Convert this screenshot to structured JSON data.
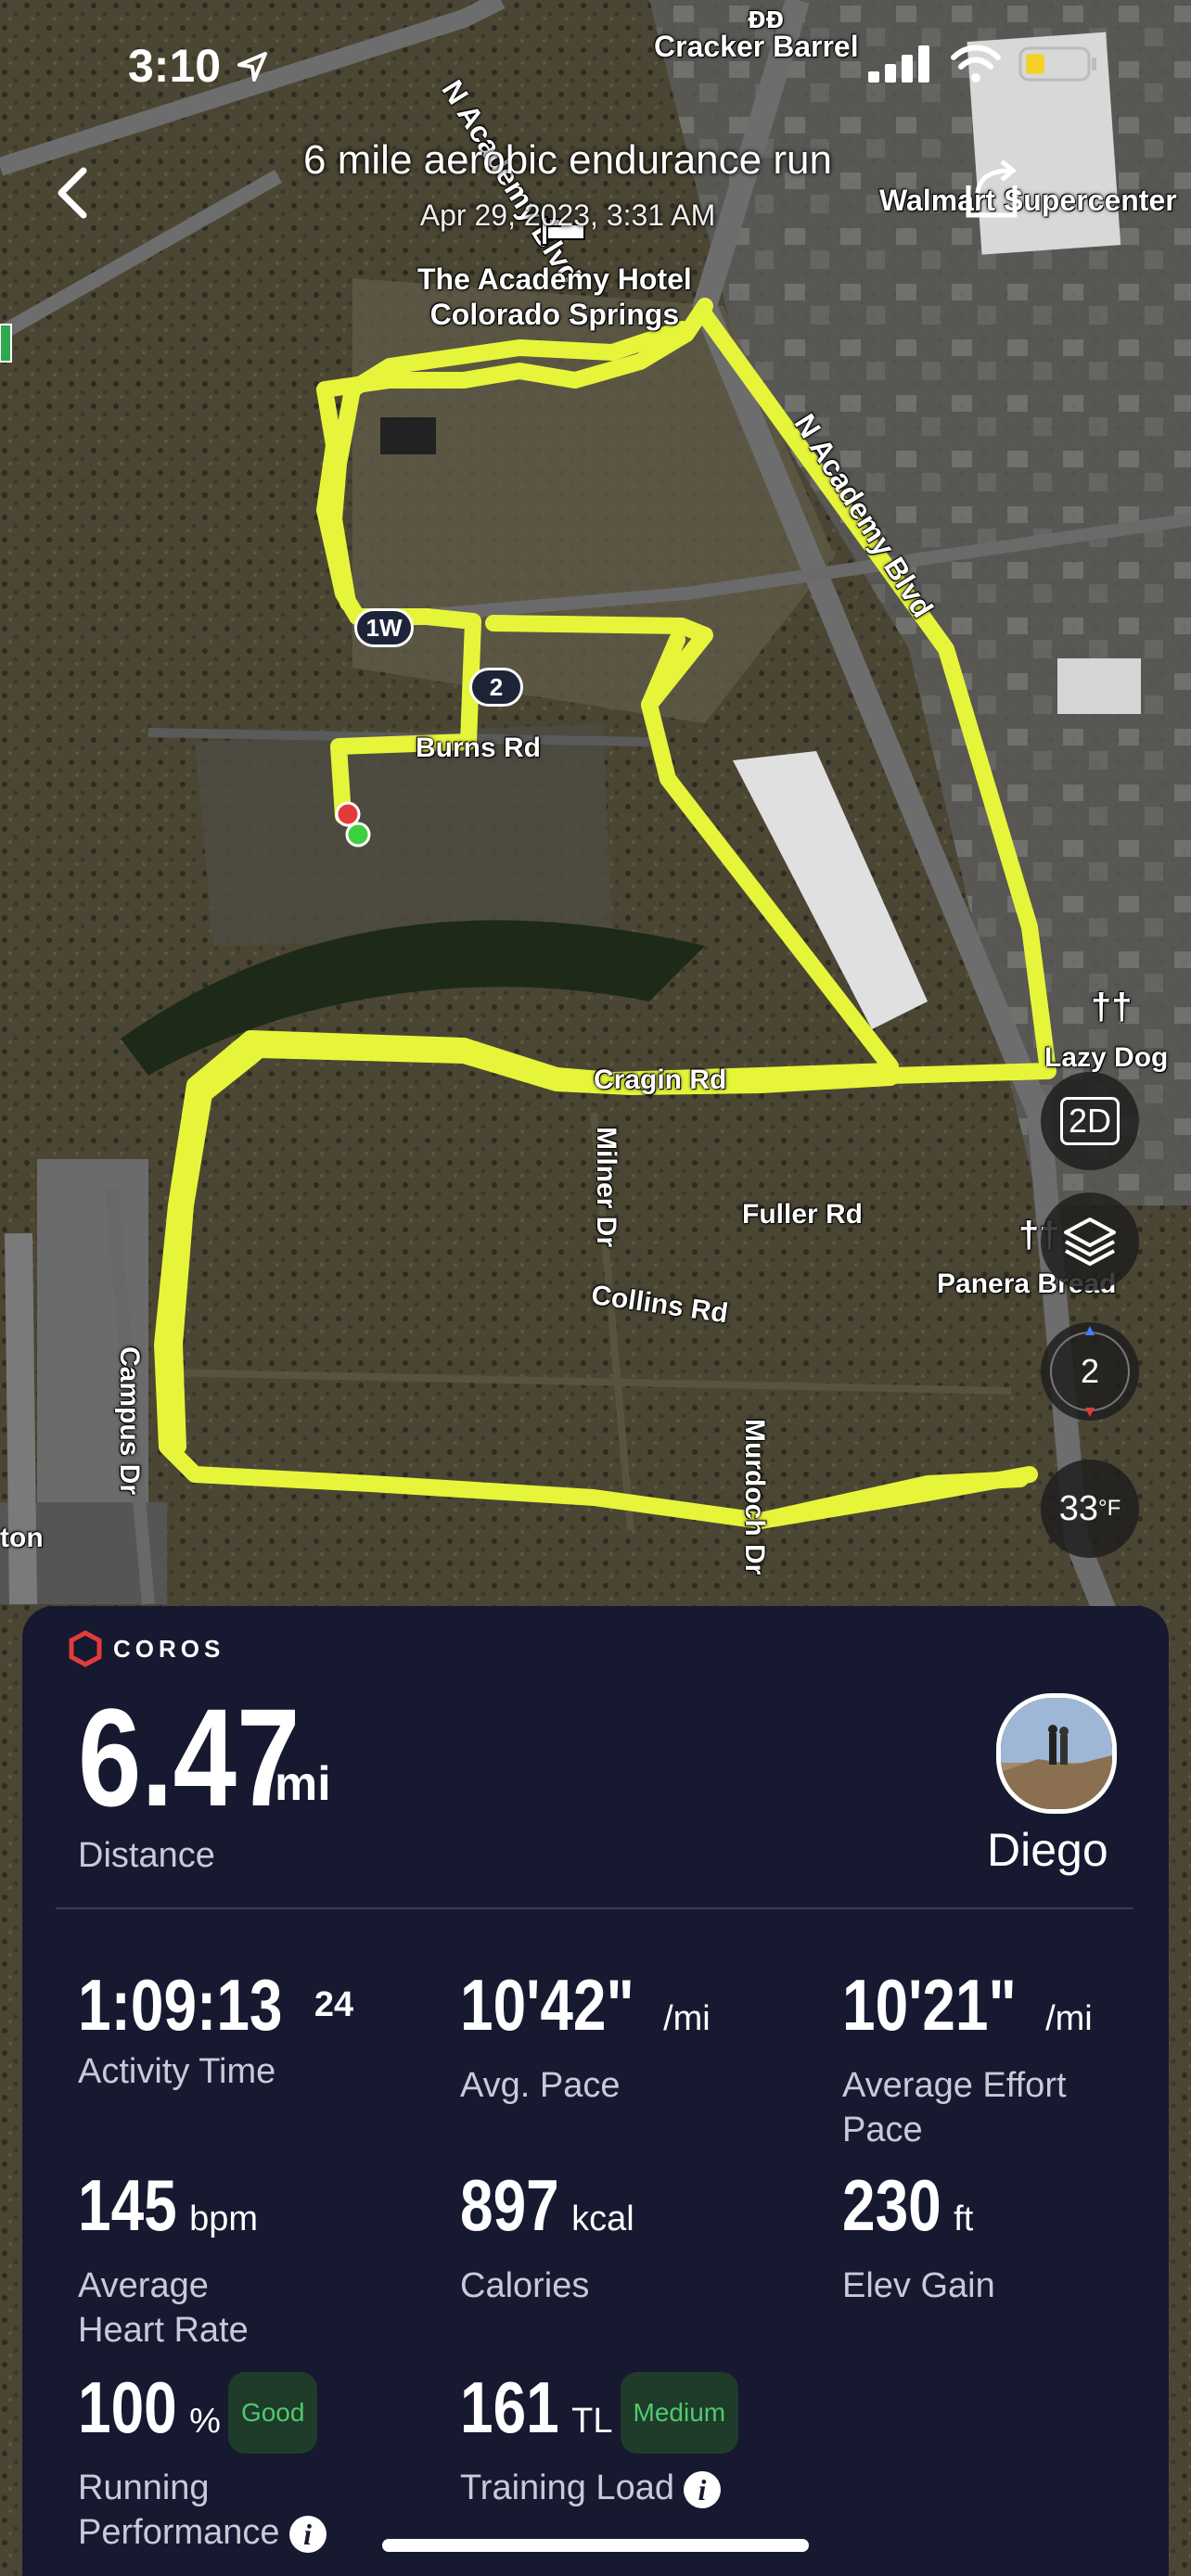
{
  "status_bar": {
    "time": "3:10"
  },
  "header": {
    "title": "6 mile aerobic endurance run",
    "date": "Apr 29, 2023, 3:31 AM"
  },
  "map": {
    "labels": {
      "academy_blvd_top": "N Academy Blvd",
      "academy_blvd_right": "N Academy Blvd",
      "cracker_barrel": "Cracker Barrel",
      "walmart": "Walmart Supercenter",
      "hotel_line1": "The Academy Hotel",
      "hotel_line2": "Colorado Springs",
      "burns_rd": "Burns Rd",
      "cragin_rd": "Cragin Rd",
      "miner_dr": "Milner Dr",
      "fuller_rd": "Fuller Rd",
      "collins_rd": "Collins Rd",
      "murdoch_dr": "Murdoch Dr",
      "campus_dr": "Campus Dr",
      "lazy_dog": "Lazy Dog",
      "panera": "Panera Bread",
      "edge_left": "ton"
    },
    "shields": {
      "route_1w": "1W",
      "route_2": "2"
    },
    "controls": {
      "view_mode": "2D",
      "compass_level": "2",
      "temperature": "33",
      "temperature_unit": "°F"
    },
    "route_color": "#e6f53a"
  },
  "card": {
    "brand": "COROS",
    "distance": {
      "value": "6.47",
      "unit": "mi",
      "label": "Distance"
    },
    "user": {
      "name": "Diego"
    },
    "stats": {
      "activity_time": {
        "value": "1:09:13",
        "sup": "24",
        "label": "Activity Time"
      },
      "avg_pace": {
        "value": "10'42\"",
        "unit": "/mi",
        "label": "Avg. Pace"
      },
      "effort_pace": {
        "value": "10'21\"",
        "unit": "/mi",
        "label": "Average Effort Pace"
      },
      "heart_rate": {
        "value": "145",
        "unit": "bpm",
        "label": "Average Heart Rate"
      },
      "calories": {
        "value": "897",
        "unit": "kcal",
        "label": "Calories"
      },
      "elev_gain": {
        "value": "230",
        "unit": "ft",
        "label": "Elev Gain"
      },
      "running_performance": {
        "value": "100",
        "unit": "%",
        "badge": "Good",
        "label": "Running Performance"
      },
      "training_load": {
        "value": "161",
        "unit": "TL",
        "badge": "Medium",
        "label": "Training Load"
      }
    },
    "accent_color": "#4ecb6c",
    "bg_color": "#161930"
  }
}
